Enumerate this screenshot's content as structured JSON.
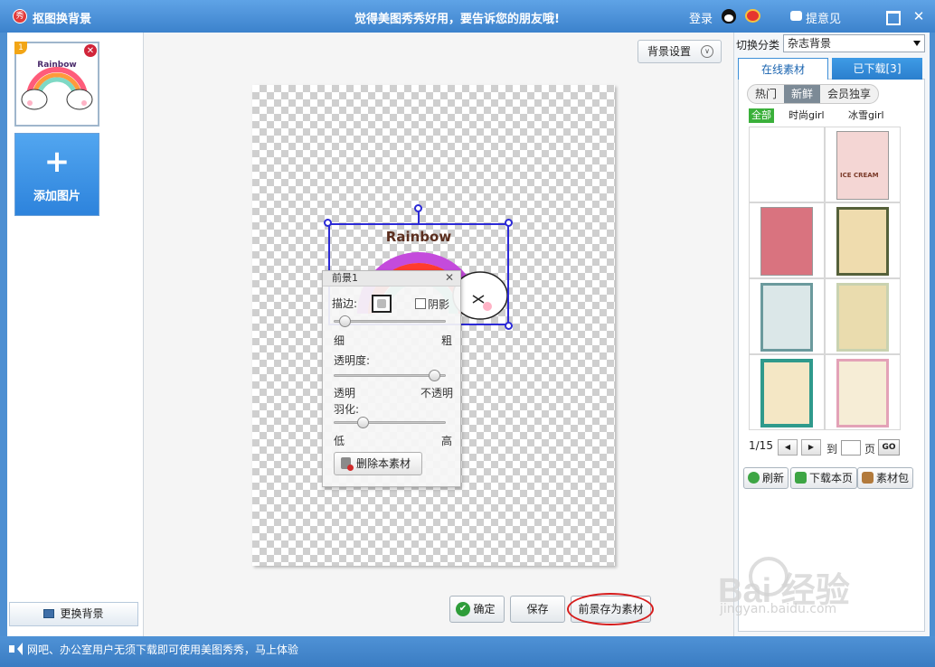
{
  "titlebar": {
    "app_icon_text": "秀",
    "title": "抠图换背景",
    "slogan": "觉得美图秀秀好用，要告诉您的朋友哦!",
    "login": "登录",
    "feedback": "提意见"
  },
  "left": {
    "thumb_index": "1",
    "thumb_label": "Rainbow",
    "add_label": "添加图片",
    "add_plus": "+",
    "change_bg": "更换背景"
  },
  "canvas": {
    "bg_setting": "背景设置",
    "sticker_text": "Rainbow"
  },
  "popup": {
    "title": "前景1",
    "stroke_label": "描边:",
    "shadow_label": "阴影",
    "thin": "细",
    "thick": "粗",
    "opacity_label": "透明度:",
    "transparent": "透明",
    "opaque": "不透明",
    "feather_label": "羽化:",
    "low": "低",
    "high": "高",
    "delete_label": "删除本素材",
    "opacity_value": 0.95,
    "feather_value": 0.23,
    "stroke_width_value": 0.05
  },
  "bottom": {
    "ok": "确定",
    "save": "保存",
    "save_material": "前景存为素材"
  },
  "right": {
    "category_label": "切换分类",
    "category_value": "杂志背景",
    "tab_online": "在线素材",
    "tab_downloaded": "已下载[3]",
    "pills": [
      "热门",
      "新鲜",
      "会员独享"
    ],
    "sub_filters": [
      "全部",
      "时尚girl",
      "冰雪girl"
    ],
    "page_info": "1/15",
    "goto_label": "到",
    "page_unit": "页",
    "go": "GO",
    "refresh": "刷新",
    "download_page": "下载本页",
    "material_pack": "素材包",
    "thumb_sub": "ICE CREAM"
  },
  "status": {
    "text": "网吧、办公室用户无须下载即可使用美图秀秀，马上体验"
  },
  "watermark": {
    "brand": "Bai 经验",
    "url": "jingyan.baidu.com"
  },
  "colors": {
    "titlebar": "#4a90d9",
    "selection": "#2c2ad6",
    "highlight_ring": "#d61c1c",
    "filter_active": "#3ab03a"
  }
}
